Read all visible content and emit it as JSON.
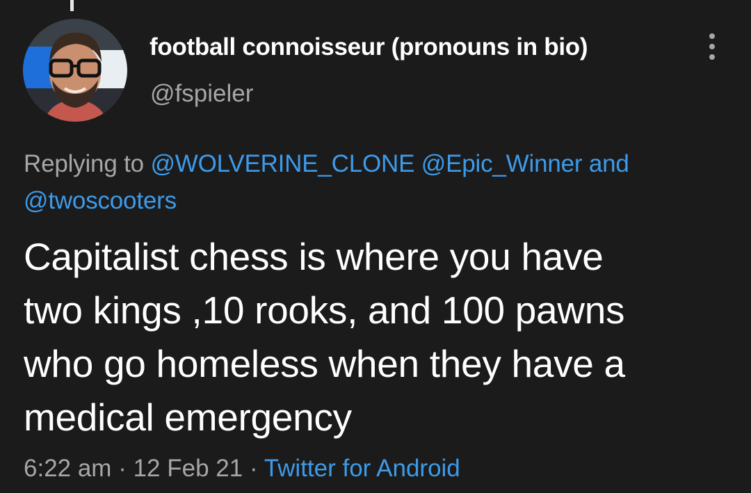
{
  "tweet": {
    "author": {
      "display_name": "football connoisseur (pronouns in bio)",
      "handle": "@fspieler",
      "avatar_icon": "profile-photo"
    },
    "more_icon": "more-vertical-icon",
    "reply_context": {
      "prefix": "Replying to",
      "mentions": [
        "@WOLVERINE_CLONE",
        "@Epic_Winner"
      ],
      "conjunction": "and",
      "last_mention": "@twoscooters"
    },
    "text": "Capitalist chess is where you have\ntwo kings ,10 rooks, and 100 pawns\nwho go homeless when they have a\nmedical emergency",
    "meta": {
      "time": "6:22 am",
      "separator": "·",
      "date": "12 Feb 21",
      "source": "Twitter for Android"
    }
  },
  "colors": {
    "background": "#1b1b1c",
    "text_primary": "#ffffff",
    "text_secondary": "#a7a7a9",
    "link": "#3d9be9"
  }
}
